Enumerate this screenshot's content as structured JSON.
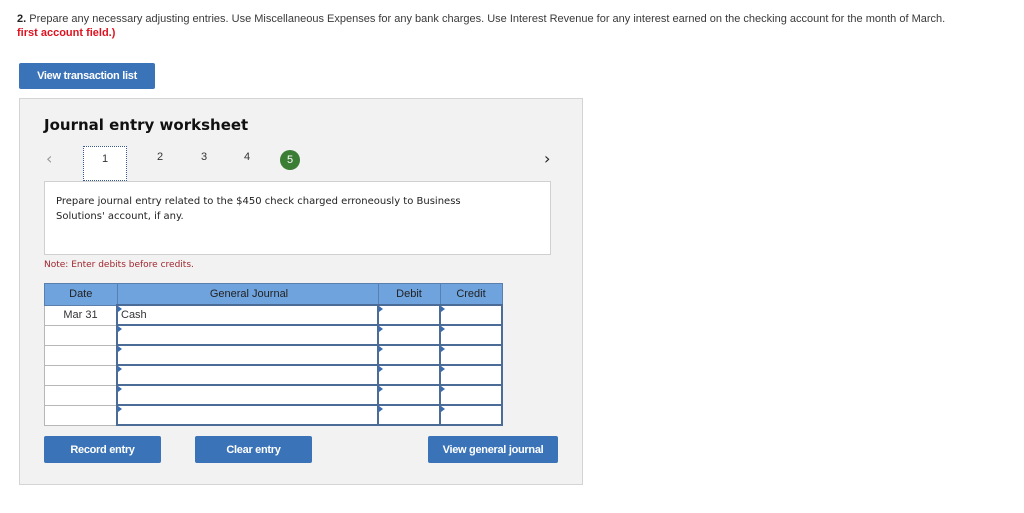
{
  "instructions": {
    "number": "2.",
    "text": " Prepare any necessary adjusting entries. Use Miscellaneous Expenses for any bank charges. Use Interest Revenue for any interest earned on the checking account for the month of March. ",
    "red_text": "first account field.)"
  },
  "buttons": {
    "view_transaction_list": "View transaction list",
    "record_entry": "Record entry",
    "clear_entry": "Clear entry",
    "view_general_journal": "View general journal"
  },
  "worksheet": {
    "title": "Journal entry worksheet",
    "nav": {
      "prev_icon": "chevron-left-icon",
      "next_icon": "chevron-right-icon",
      "steps": [
        "1",
        "2",
        "3",
        "4",
        "5"
      ],
      "current_step": "1",
      "completed_step": "5"
    },
    "description": "Prepare journal entry related to the $450 check charged erroneously to Business Solutions' account, if any.",
    "note": "Note: Enter debits before credits."
  },
  "journal": {
    "headers": [
      "Date",
      "General Journal",
      "Debit",
      "Credit"
    ],
    "rows": [
      {
        "date": "Mar 31",
        "account": "Cash",
        "debit": "",
        "credit": ""
      },
      {
        "date": "",
        "account": "",
        "debit": "",
        "credit": ""
      },
      {
        "date": "",
        "account": "",
        "debit": "",
        "credit": ""
      },
      {
        "date": "",
        "account": "",
        "debit": "",
        "credit": ""
      },
      {
        "date": "",
        "account": "",
        "debit": "",
        "credit": ""
      },
      {
        "date": "",
        "account": "",
        "debit": "",
        "credit": ""
      }
    ]
  },
  "colors": {
    "button_blue": "#3a73b8",
    "header_blue": "#6fa3de",
    "step_done_green": "#3b7d35",
    "warning_red": "#e0121f"
  }
}
